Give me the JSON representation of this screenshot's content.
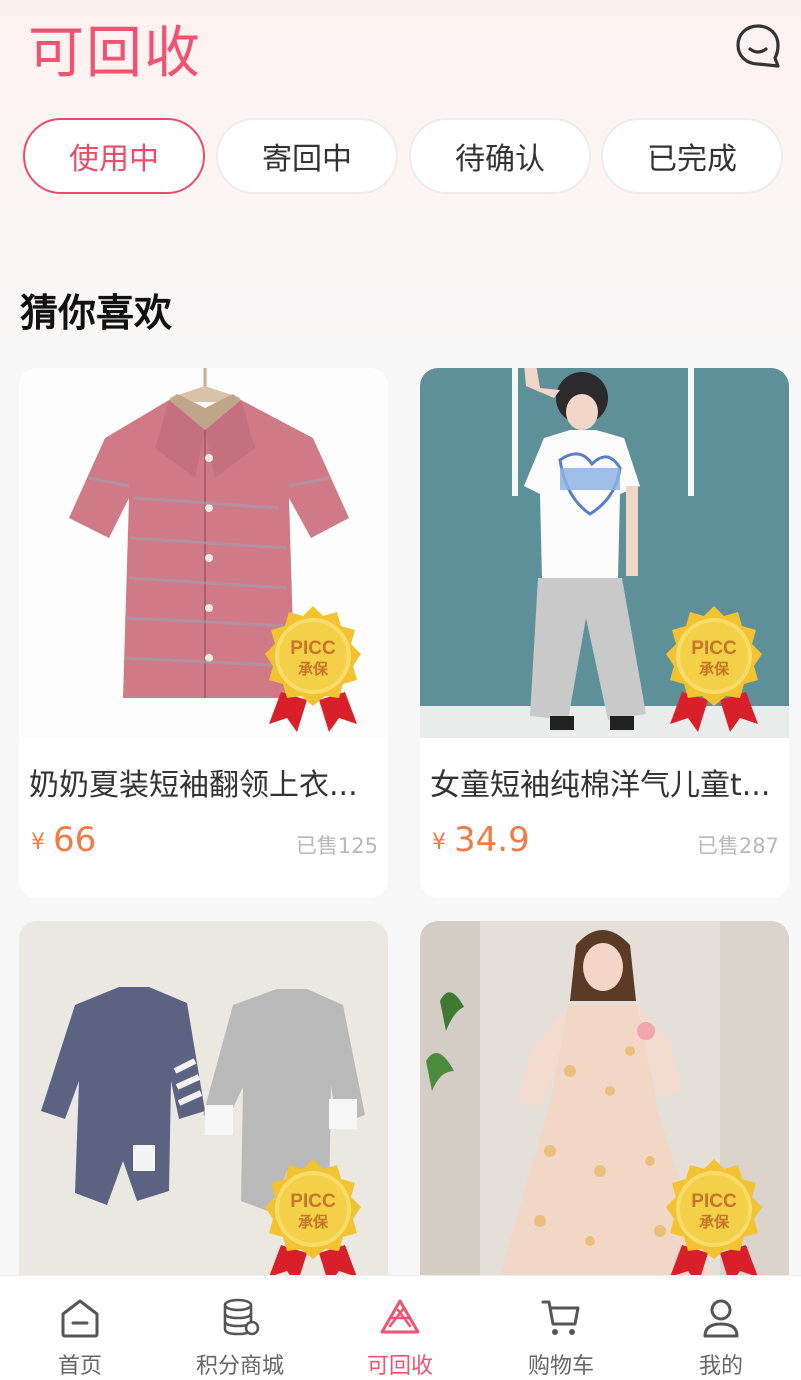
{
  "header": {
    "title": "可回收"
  },
  "tabs": [
    {
      "label": "使用中"
    },
    {
      "label": "寄回中"
    },
    {
      "label": "待确认"
    },
    {
      "label": "已完成"
    }
  ],
  "section": {
    "title": "猜你喜欢"
  },
  "badge": {
    "line1": "PICC",
    "line2": "承保"
  },
  "products": [
    {
      "name": "奶奶夏装短袖翻领上衣...",
      "currency": "¥",
      "price": "66",
      "sold": "已售125"
    },
    {
      "name": "女童短袖纯棉洋气儿童t...",
      "currency": "¥",
      "price": "34.9",
      "sold": "已售287"
    },
    {
      "name": "",
      "currency": "",
      "price": "",
      "sold": ""
    },
    {
      "name": "",
      "currency": "",
      "price": "",
      "sold": ""
    }
  ],
  "tabbar": [
    {
      "label": "首页",
      "icon": "home-icon"
    },
    {
      "label": "积分商城",
      "icon": "coins-icon"
    },
    {
      "label": "可回收",
      "icon": "recycle-icon"
    },
    {
      "label": "购物车",
      "icon": "cart-icon"
    },
    {
      "label": "我的",
      "icon": "user-icon"
    }
  ],
  "colors": {
    "accent": "#f0536f",
    "price": "#f27b45",
    "badge_gold": "#f2c230",
    "ribbon": "#d81f2a"
  }
}
